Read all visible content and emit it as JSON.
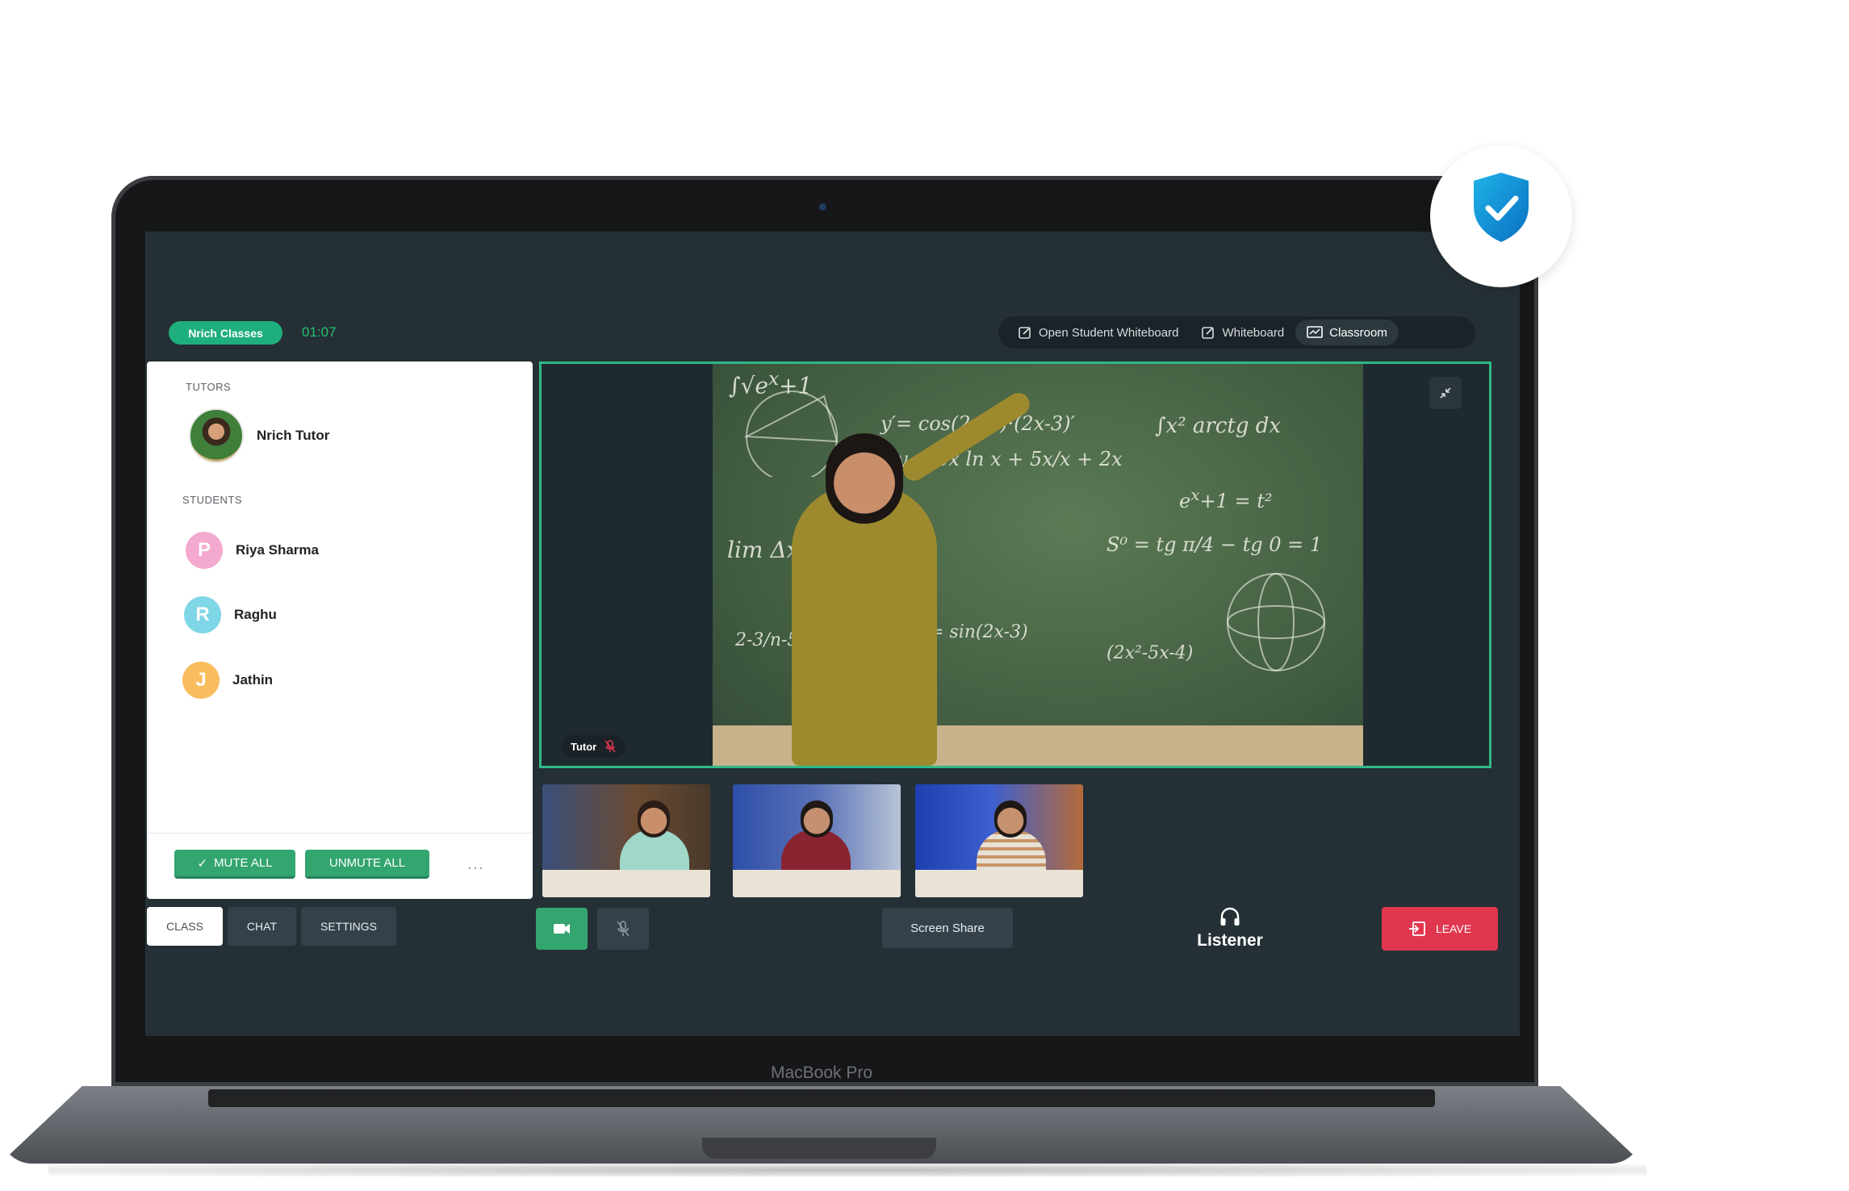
{
  "header": {
    "brand": "Nrich Classes",
    "timer": "01:07"
  },
  "topnav": {
    "items": [
      {
        "label": "Open Student Whiteboard",
        "icon": "edit-icon",
        "active": false
      },
      {
        "label": "Whiteboard",
        "icon": "edit-icon",
        "active": false
      },
      {
        "label": "Classroom",
        "icon": "presentation-icon",
        "active": true
      }
    ]
  },
  "participants": {
    "tutors_label": "TUTORS",
    "tutors": [
      {
        "name": "Nrich Tutor"
      }
    ],
    "students_label": "STUDENTS",
    "students": [
      {
        "name": "Riya Sharma",
        "initial": "P",
        "color": "#f4a9d0"
      },
      {
        "name": "Raghu",
        "initial": "R",
        "color": "#7fd6e6"
      },
      {
        "name": "Jathin",
        "initial": "J",
        "color": "#f9bd5d"
      }
    ]
  },
  "actions": {
    "mute_all": "MUTE ALL",
    "unmute_all": "UNMUTE ALL",
    "more": "···"
  },
  "tabs": [
    {
      "label": "CLASS"
    },
    {
      "label": "CHAT"
    },
    {
      "label": "SETTINGS"
    }
  ],
  "video": {
    "tutor_tag": "Tutor"
  },
  "controls": {
    "screen_share": "Screen Share",
    "listener": "Listener",
    "leave": "LEAVE"
  },
  "device": {
    "label": "MacBook Pro"
  },
  "colors": {
    "accent": "#2fb987",
    "leave": "#e0374f",
    "panel_bg": "#253036"
  }
}
